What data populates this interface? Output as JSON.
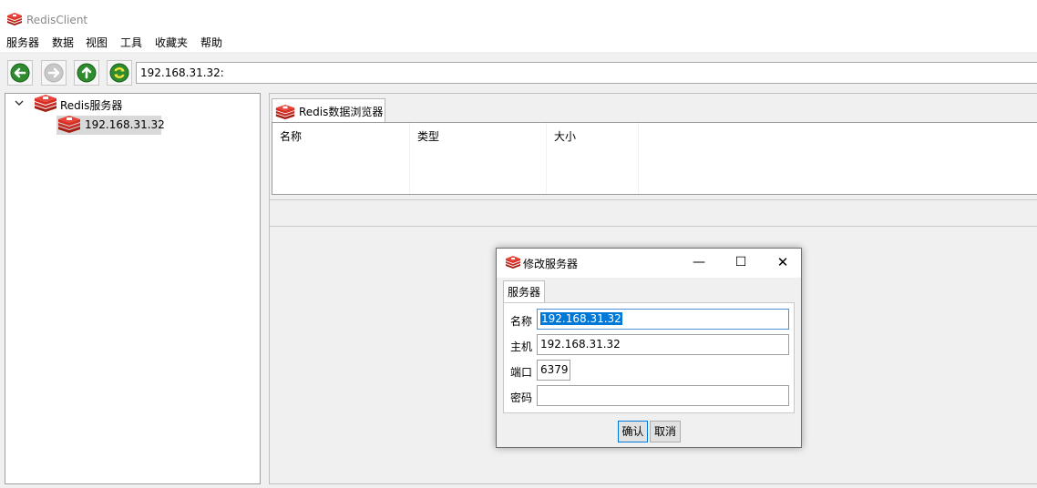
{
  "app": {
    "title": "RedisClient"
  },
  "menu": {
    "items": [
      "服务器",
      "数据",
      "视图",
      "工具",
      "收藏夹",
      "帮助"
    ]
  },
  "toolbar": {
    "buttons": [
      "back-icon",
      "forward-icon",
      "up-icon",
      "refresh-icon"
    ],
    "address": "192.168.31.32:"
  },
  "tree": {
    "root": {
      "label": "Redis服务器",
      "icon": "redis-icon",
      "expanded": true
    },
    "children": [
      {
        "label": "192.168.31.32",
        "icon": "redis-icon",
        "selected": true
      }
    ]
  },
  "browser": {
    "tab_label": "Redis数据浏览器",
    "columns": [
      "名称",
      "类型",
      "大小"
    ]
  },
  "dialog": {
    "title": "修改服务器",
    "tab": "服务器",
    "fields": [
      {
        "label": "名称",
        "value": "192.168.31.32"
      },
      {
        "label": "主机",
        "value": "192.168.31.32"
      },
      {
        "label": "端口",
        "value": "6379"
      },
      {
        "label": "密码",
        "value": ""
      }
    ],
    "ok_label": "确认",
    "cancel_label": "取消",
    "minimize_glyph": "—",
    "maximize_glyph": "☐",
    "close_glyph": "✕"
  },
  "colors": {
    "redis_red": "#d82c20",
    "selection": "#0078d7",
    "nav_green": "#2e8b2e"
  }
}
